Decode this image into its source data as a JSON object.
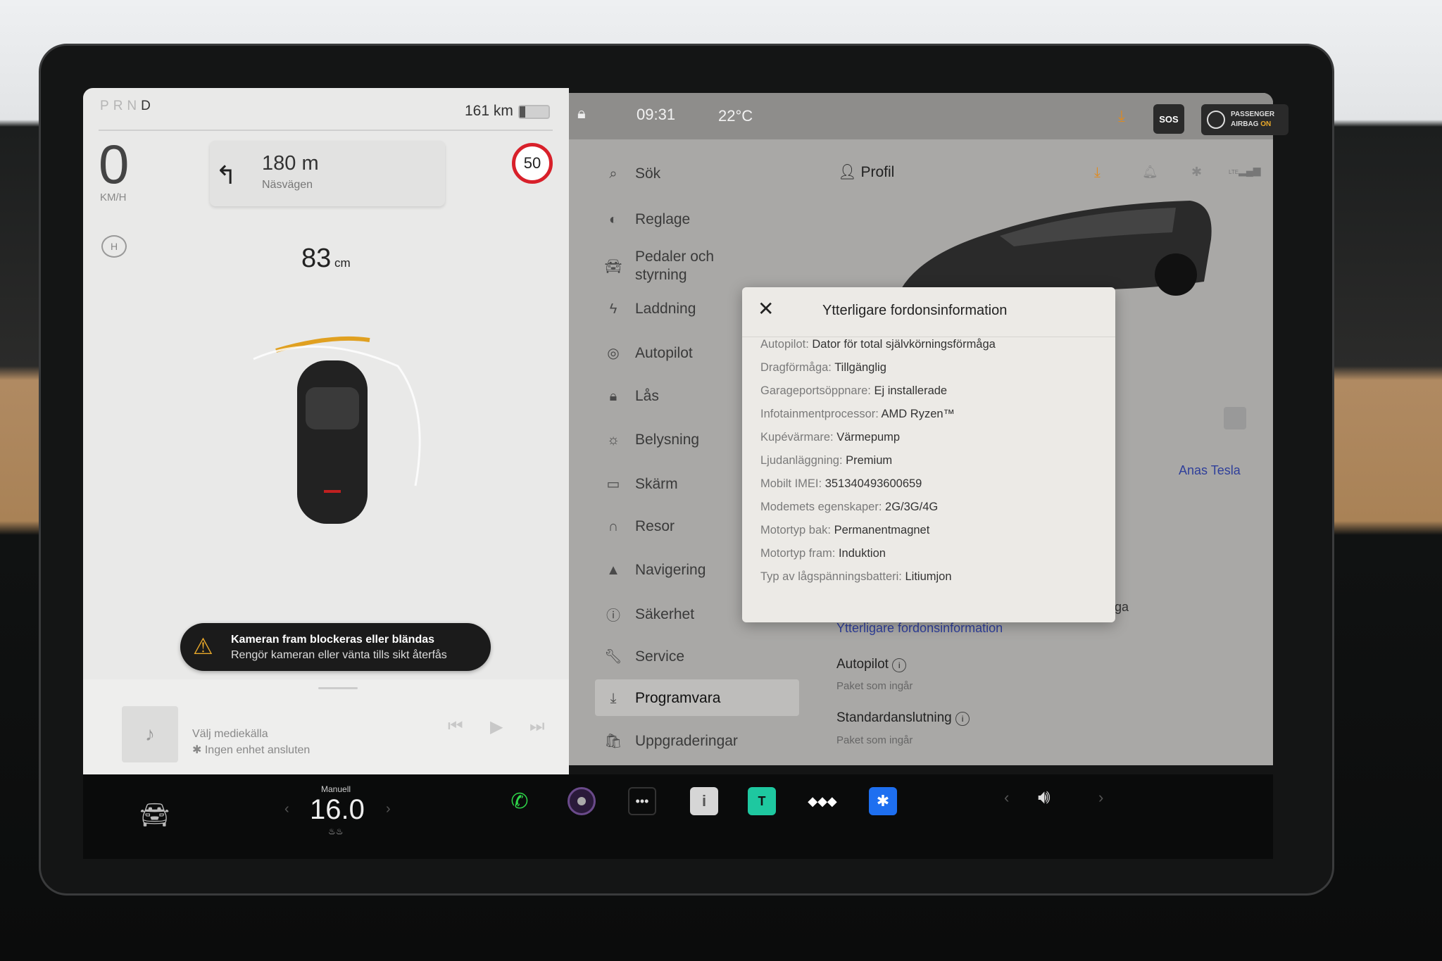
{
  "driving": {
    "gears": [
      "P",
      "R",
      "N",
      "D"
    ],
    "active_gear": "D",
    "range": "161 km",
    "battery_percent": 20,
    "speed": "0",
    "speed_unit": "KM/H",
    "nav_distance": "180 m",
    "nav_street": "Näsvägen",
    "speed_limit": "50",
    "park_distance": "83",
    "park_unit": "cm"
  },
  "warning": {
    "title": "Kameran fram blockeras eller bländas",
    "subtitle": "Rengör kameran eller vänta tills sikt återfås"
  },
  "media": {
    "source": "Välj mediekälla",
    "status": "Ingen enhet ansluten"
  },
  "status": {
    "time": "09:31",
    "temp": "22°C",
    "sos": "SOS",
    "airbag_line1": "PASSENGER",
    "airbag_line2": "AIRBAG",
    "airbag_state": "ON",
    "lte": "LTE"
  },
  "menu": [
    {
      "label": "Sök",
      "icon": "search"
    },
    {
      "label": "Reglage",
      "icon": "toggle"
    },
    {
      "label": "Pedaler och styrning",
      "icon": "car"
    },
    {
      "label": "Laddning",
      "icon": "bolt"
    },
    {
      "label": "Autopilot",
      "icon": "steering-wheel"
    },
    {
      "label": "Lås",
      "icon": "lock"
    },
    {
      "label": "Belysning",
      "icon": "sun"
    },
    {
      "label": "Skärm",
      "icon": "display"
    },
    {
      "label": "Resor",
      "icon": "trips"
    },
    {
      "label": "Navigering",
      "icon": "navigation"
    },
    {
      "label": "Säkerhet",
      "icon": "alert"
    },
    {
      "label": "Service",
      "icon": "wrench"
    },
    {
      "label": "Programvara",
      "icon": "download",
      "active": true
    },
    {
      "label": "Uppgraderingar",
      "icon": "bag"
    }
  ],
  "content": {
    "profile": "Profil",
    "car_name": "Anas Tesla",
    "partial": "åga",
    "more_info_link": "Ytterligare fordonsinformation",
    "packages": [
      {
        "name": "Autopilot",
        "note": "Paket som ingår"
      },
      {
        "name": "Standardanslutning",
        "note": "Paket som ingår"
      }
    ]
  },
  "modal": {
    "title": "Ytterligare fordonsinformation",
    "rows": [
      {
        "k": "Autopilot:",
        "v": "Dator för total självkörningsförmåga"
      },
      {
        "k": "Dragförmåga:",
        "v": "Tillgänglig"
      },
      {
        "k": "Garageportsöppnare:",
        "v": "Ej installerade"
      },
      {
        "k": "Infotainmentprocessor:",
        "v": "AMD Ryzen™"
      },
      {
        "k": "Kupévärmare:",
        "v": "Värmepump"
      },
      {
        "k": "Ljudanläggning:",
        "v": "Premium"
      },
      {
        "k": "Mobilt IMEI:",
        "v": "351340493600659"
      },
      {
        "k": "Modemets egenskaper:",
        "v": "2G/3G/4G"
      },
      {
        "k": "Motortyp bak:",
        "v": "Permanentmagnet"
      },
      {
        "k": "Motortyp fram:",
        "v": "Induktion"
      },
      {
        "k": "Typ av lågspänningsbatteri:",
        "v": "Litiumjon"
      }
    ]
  },
  "dock": {
    "climate_mode": "Manuell",
    "temperature": "16.0"
  },
  "colors": {
    "accent_orange": "#e08a1e",
    "link_blue": "#2f3f9a",
    "speed_limit_red": "#d8202a",
    "phone_green": "#2fd84a",
    "bluetooth_blue": "#1e6ff0"
  }
}
